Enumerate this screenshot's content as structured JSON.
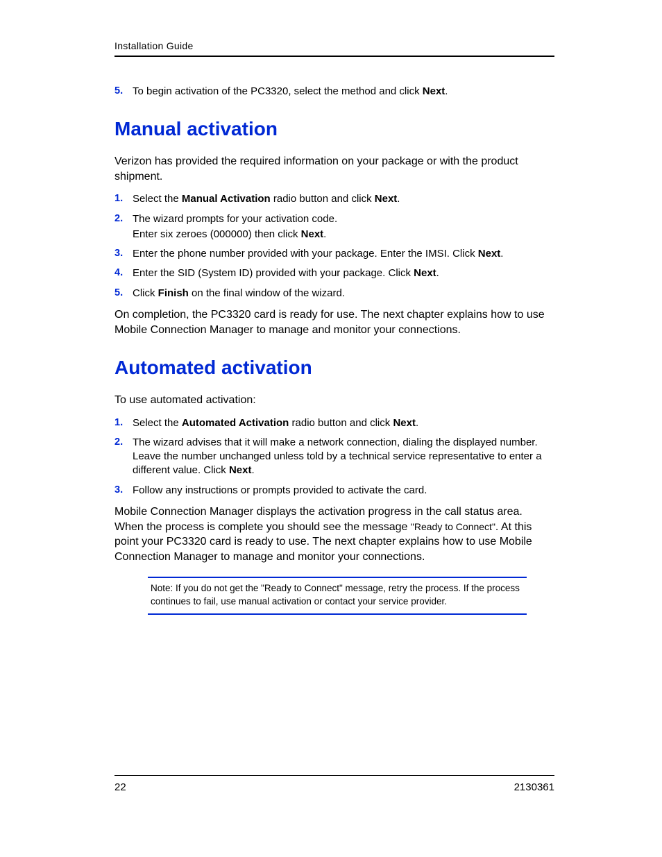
{
  "header": "Installation Guide",
  "intro": {
    "num": "5.",
    "pre": "To begin activation of the PC3320, select the method and click ",
    "bold": "Next",
    "post": "."
  },
  "manual": {
    "title": "Manual activation",
    "para": "Verizon has provided the required information on your package or with the product shipment.",
    "items": [
      {
        "num": "1.",
        "pre": "Select the ",
        "b1": "Manual Activation",
        "mid": " radio button and click ",
        "b2": "Next",
        "post": "."
      },
      {
        "num": "2.",
        "line1": "The wizard prompts for your activation code.",
        "line2_pre": "Enter six zeroes (",
        "line2_zeros": "000000",
        "line2_mid": ") then click ",
        "line2_b": "Next",
        "line2_post": "."
      },
      {
        "num": "3.",
        "pre": "Enter the phone number provided with your package. Enter the IMSI. Click ",
        "b1": "Next",
        "post": "."
      },
      {
        "num": "4.",
        "pre": "Enter the SID (System ID) provided with your package. Click ",
        "b1": "Next",
        "post": "."
      },
      {
        "num": "5.",
        "pre": "Click ",
        "b1": "Finish",
        "post": " on the final window of the wizard."
      }
    ],
    "closing": "On completion, the PC3320 card is ready for use. The next chapter explains how to use Mobile Connection Manager to manage and monitor your connections."
  },
  "auto": {
    "title": "Automated activation",
    "para": "To use automated activation:",
    "items": [
      {
        "num": "1.",
        "pre": "Select the ",
        "b1": "Automated Activation",
        "mid": " radio button and click ",
        "b2": "Next",
        "post": "."
      },
      {
        "num": "2.",
        "pre": "The wizard advises that it will make a network connection, dialing the displayed number. Leave the number unchanged unless told by a technical service representative to enter a different value. Click ",
        "b1": "Next",
        "post": "."
      },
      {
        "num": "3.",
        "pre": "Follow any instructions or prompts provided to activate the card."
      }
    ],
    "closing_pre": "Mobile Connection Manager displays the activation progress in the call status area. When the process is complete you should see the message ",
    "closing_q": "\"Ready to Connect\"",
    "closing_post": ". At this point your PC3320 card is ready to use.  The next chapter explains how to use Mobile Connection Manager to manage and monitor your connections."
  },
  "note": "Note:  If you do not get the \"Ready to Connect\" message, retry the process. If the process continues to fail, use manual activation or contact your service provider.",
  "footer": {
    "page": "22",
    "docnum": "2130361"
  }
}
